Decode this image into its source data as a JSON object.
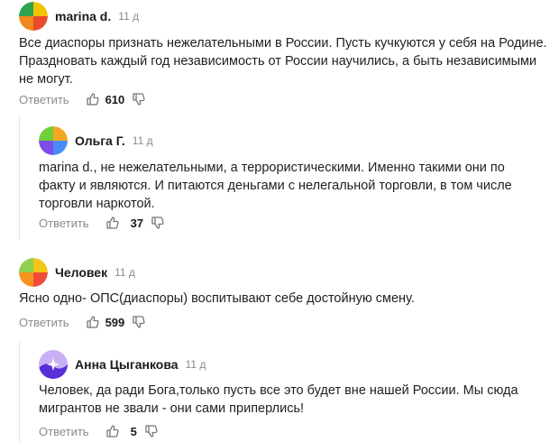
{
  "comments": [
    {
      "author": "marina d.",
      "time": "11 д",
      "lines": [
        "Все диаспоры признать нежелательными в России. Пусть кучкуются у себя на Родине.",
        "Праздновать каждый год независимость от России научились, а быть независимыми",
        "не могут."
      ],
      "reply_label": "Ответить",
      "likes": "610",
      "avatar_colors": [
        "#f2c300",
        "#2ea44f",
        "#e84b2f",
        "#f08a1c"
      ]
    },
    {
      "author": "Ольга Г.",
      "time": "11 д",
      "lines": [
        "marina d., не нежелательными, а террористическими. Именно такими они по",
        "факту и являются. И питаются деньгами с нелегальной торговли, в том числе",
        "торговли наркотой."
      ],
      "reply_label": "Ответить",
      "likes": "37",
      "avatar_colors": [
        "#f5a623",
        "#6fcf3a",
        "#4a8cf7",
        "#7e4ce6"
      ]
    },
    {
      "author": "Человек",
      "time": "11 д",
      "lines": [
        "Ясно одно- ОПС(диаспоры) воспитывают себе достойную смену."
      ],
      "reply_label": "Ответить",
      "likes": "599",
      "avatar_colors": [
        "#f5c518",
        "#8fd14f",
        "#ef4a3a",
        "#f7931e"
      ]
    },
    {
      "author": "Анна Цыганкова",
      "time": "11 д",
      "lines": [
        "Человек, да ради Бога,только пусть все это будет вне нашей России. Мы сюда",
        "мигрантов не звали - они сами приперлись!"
      ],
      "reply_label": "Ответить",
      "likes": "5",
      "avatar_colors": [
        "#b58cf2",
        "#5a2fd6",
        "#ffffff",
        "#7b4ff0"
      ]
    }
  ]
}
